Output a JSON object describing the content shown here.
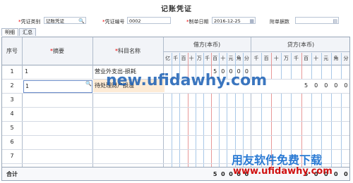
{
  "title": "记账凭证",
  "header": {
    "voucher_type_label": "凭证类别",
    "voucher_type_value": "记账凭证",
    "voucher_no_label": "凭证编号",
    "voucher_no_value": "0002",
    "date_label": "制单日期",
    "date_value": "2016-12-25",
    "attachments_label": "附单据数",
    "attachments_value": ""
  },
  "tabs": [
    {
      "label": "明细"
    },
    {
      "label": "汇总"
    }
  ],
  "columns": {
    "seq": "序号",
    "summary": "摘要",
    "account": "科目名称",
    "debit": "借方(本币)",
    "credit": "贷方(本币)",
    "debit_digits": [
      "亿",
      "千",
      "百",
      "十",
      "万",
      "千",
      "百",
      "十",
      "元",
      "角",
      "分"
    ],
    "credit_digits": [
      "千",
      "百",
      "十",
      "万",
      "千",
      "百",
      "十",
      "元",
      "角",
      "分"
    ]
  },
  "rows": [
    {
      "seq": "1",
      "summary": "1",
      "account": "营业外支出-损耗",
      "debit": "500",
      "credit": ""
    },
    {
      "seq": "2",
      "summary": "1",
      "account": "待处理财产损溢",
      "debit": "",
      "credit": "500"
    },
    {
      "seq": "3",
      "summary": "",
      "account": "",
      "debit": "",
      "credit": ""
    },
    {
      "seq": "4",
      "summary": "",
      "account": "",
      "debit": "",
      "credit": ""
    },
    {
      "seq": "5",
      "summary": "",
      "account": "",
      "debit": "",
      "credit": ""
    },
    {
      "seq": "6",
      "summary": "",
      "account": "",
      "debit": "",
      "credit": ""
    },
    {
      "seq": "7",
      "summary": "",
      "account": "",
      "debit": "",
      "credit": ""
    }
  ],
  "total": {
    "label": "合计",
    "debit": "500",
    "credit": "500"
  },
  "watermarks": {
    "center": "new.ufidawhy.com",
    "corner_title": "用友软件免费下载",
    "corner_url": "www.ufidawhy.com"
  },
  "colors": {
    "accent_blue": "#1a5fb4",
    "watermark_red": "#d01010",
    "grid_border": "#98a6b8"
  }
}
